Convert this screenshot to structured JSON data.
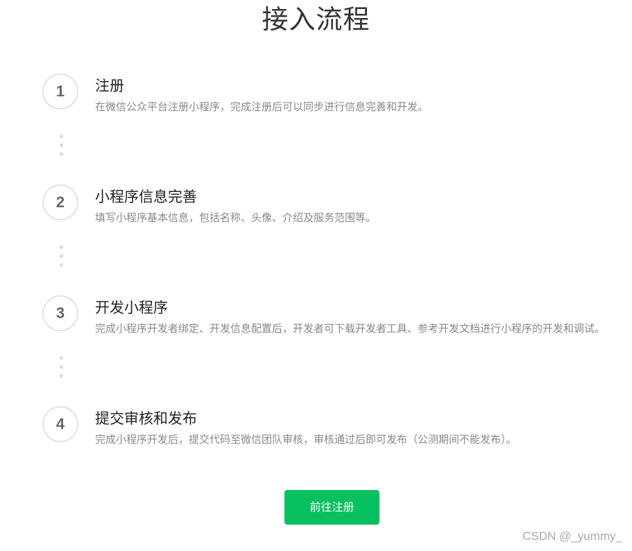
{
  "page": {
    "title": "接入流程"
  },
  "steps": [
    {
      "number": "1",
      "title": "注册",
      "description": "在微信公众平台注册小程序，完成注册后可以同步进行信息完善和开发。"
    },
    {
      "number": "2",
      "title": "小程序信息完善",
      "description": "填写小程序基本信息，包括名称、头像、介绍及服务范围等。"
    },
    {
      "number": "3",
      "title": "开发小程序",
      "description": "完成小程序开发者绑定、开发信息配置后，开发者可下载开发者工具、参考开发文档进行小程序的开发和调试。"
    },
    {
      "number": "4",
      "title": "提交审核和发布",
      "description": "完成小程序开发后，提交代码至微信团队审核，审核通过后即可发布（公测期间不能发布）。"
    }
  ],
  "actions": {
    "register_label": "前往注册"
  },
  "watermark": {
    "text": "CSDN @_yummy_"
  },
  "colors": {
    "accent": "#07c160",
    "circle_border": "#e2e2e2",
    "description_text": "#888888",
    "dot": "#d9d9d9"
  }
}
